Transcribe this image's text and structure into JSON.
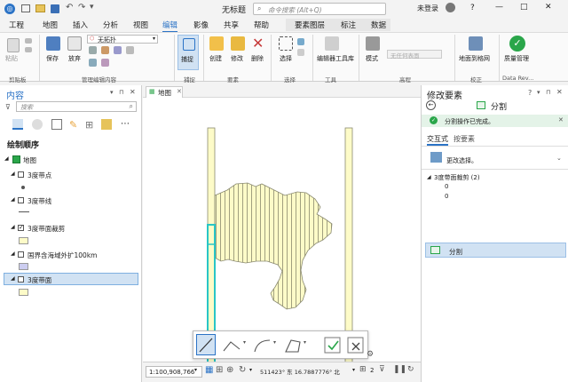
{
  "titlebar": {
    "title": "无标题",
    "search_placeholder": "命令搜索 (Alt+Q)",
    "user": "未登录",
    "help": "?",
    "minimize": "—",
    "maximize": "□",
    "close": "✕"
  },
  "tabs": [
    {
      "label": "工程"
    },
    {
      "label": "地图"
    },
    {
      "label": "插入"
    },
    {
      "label": "分析"
    },
    {
      "label": "视图"
    },
    {
      "label": "编辑"
    },
    {
      "label": "影像"
    },
    {
      "label": "共享"
    },
    {
      "label": "帮助"
    },
    {
      "label": "要素图层"
    },
    {
      "label": "标注"
    },
    {
      "label": "数据"
    }
  ],
  "ribbon": {
    "paste": "粘贴",
    "save": "保存",
    "discard": "放弃",
    "topology_value": "无拓扑",
    "snap": "捕捉",
    "create": "创建",
    "modify": "修改",
    "delete": "删除",
    "select": "选择",
    "manage_templates": "编辑器工具库",
    "attributes": "模式",
    "no_table": "无任何表面",
    "ground_to_grid": "地面到格网",
    "quality": "质量管理",
    "groups": {
      "clipboard": "剪贴板",
      "manage": "管理编辑内容",
      "snapping": "捕捉",
      "features": "要素",
      "selection": "选择",
      "tools": "工具",
      "elevation": "高程",
      "correction": "校正",
      "data_review": "Data Rev..."
    }
  },
  "contents": {
    "title": "内容",
    "search_placeholder": "搜索",
    "drawing_order": "绘制顺序",
    "map": "地图",
    "layers": [
      {
        "name": "3度带点",
        "checked": false,
        "symbol": "dot"
      },
      {
        "name": "3度带线",
        "checked": false,
        "symbol": "line"
      },
      {
        "name": "3度带面裁剪",
        "checked": true,
        "symbol": "fill",
        "color": "#fdfbc8"
      },
      {
        "name": "国界含海域外扩100km",
        "checked": false,
        "symbol": "fill",
        "color": "#cccdf0"
      },
      {
        "name": "3度带面",
        "checked": false,
        "symbol": "fill",
        "color": "#fdfbc8",
        "selected": true
      }
    ]
  },
  "map": {
    "tab": "地图",
    "scale": "1:100,908,766",
    "coords": "511423° 东 16.7887776° 北",
    "sel_count": "2"
  },
  "modify": {
    "title": "修改要素",
    "tool": "分割",
    "status": "分割操作已完成。",
    "tab_interactive": "交互式",
    "tab_attributes": "按要素",
    "change_selection": "更改选择。",
    "layer_entry": "3度带面裁剪 (2)",
    "ids": [
      "0",
      "0"
    ],
    "bottom_tool": "分割"
  },
  "colors": {
    "accent": "#2b73c6",
    "ribbon_active": "#d1e2f3",
    "feature_fill": "#fdfbc8",
    "feature_line": "#8a8a70",
    "selection": "#29c6c6",
    "success": "#2aa64a"
  }
}
